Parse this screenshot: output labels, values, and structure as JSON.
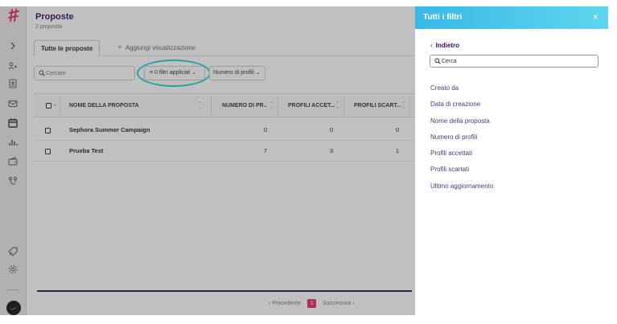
{
  "main": {
    "title": "Proposte",
    "subtitle": "2 proposta",
    "tabs": {
      "active": "Tutte le proposte",
      "add": "Aggiungi visualizzazione"
    },
    "search_placeholder": "Cercare",
    "filter_button": "0 filtri applicati",
    "profile_filter_button": "Numero di profili",
    "columns": [
      "NOME DELLA PROPOSTA",
      "NUMERO DI PR...",
      "PROFILI ACCET...",
      "PROFILI SCART..."
    ],
    "rows": [
      {
        "name": "Sephora Summer Campaign",
        "numero": "0",
        "accettati": "0",
        "scartati": "0"
      },
      {
        "name": "Prueba Test",
        "numero": "7",
        "accettati": "3",
        "scartati": "1"
      }
    ],
    "pagination": {
      "prev": "Precedente",
      "page": "1",
      "next": "Successiva"
    }
  },
  "panel": {
    "title": "Tutti i filtri",
    "close": "×",
    "back": "Indietro",
    "search_placeholder": "Cerca",
    "filters": [
      "Creato da",
      "Data di creazione",
      "Nome della proposta",
      "Numero di profili",
      "Profili accettati",
      "Profili scartati",
      "Ultimo aggiornamento"
    ]
  },
  "colors": {
    "accent": "#e8266a",
    "brand": "#2e1065",
    "panel_header": "#3ab8e6",
    "highlight_ring": "#22d3d8"
  }
}
